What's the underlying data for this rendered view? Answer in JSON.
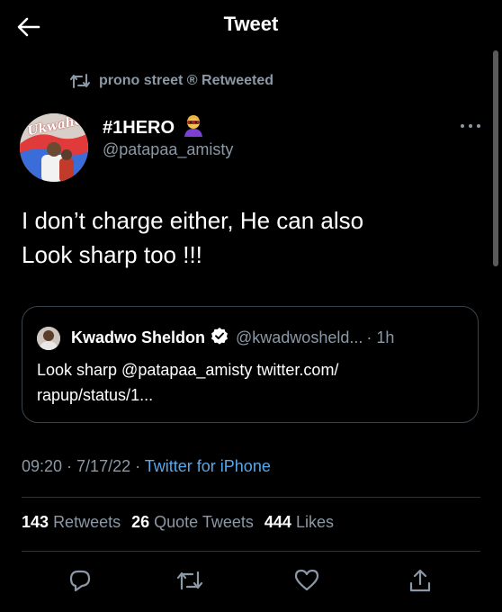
{
  "header": {
    "title": "Tweet",
    "back_icon": "arrow-left-icon"
  },
  "retweet_context": {
    "text": "prono street ® Retweeted",
    "icon": "retweet-icon"
  },
  "author": {
    "name": "#1HERO",
    "handle": "@patapaa_amisty",
    "avatar_text": "Ukwahe",
    "emoji_icon": "superhero-emoji-icon"
  },
  "tweet": {
    "text": "I don’t charge either, He can also\nLook sharp too !!!"
  },
  "quote": {
    "name": "Kwadwo Sheldon",
    "handle": "@kwadwosheld...",
    "time": "· 1h",
    "text": "Look sharp @patapaa_amisty twitter.com/\nrapup/status/1..."
  },
  "meta": {
    "time": "09:20",
    "sep1": " · ",
    "date": "7/17/22",
    "sep2": " · ",
    "source": "Twitter for iPhone"
  },
  "stats": {
    "retweets_count": "143",
    "retweets_label": "Retweets",
    "quotes_count": "26",
    "quotes_label": "Quote Tweets",
    "likes_count": "444",
    "likes_label": "Likes"
  },
  "colors": {
    "background": "#000000",
    "text_primary": "#ffffff",
    "text_secondary": "#8b98a5",
    "link": "#5aa7e8",
    "verified": "#ffffff",
    "border": "#2f3336"
  }
}
